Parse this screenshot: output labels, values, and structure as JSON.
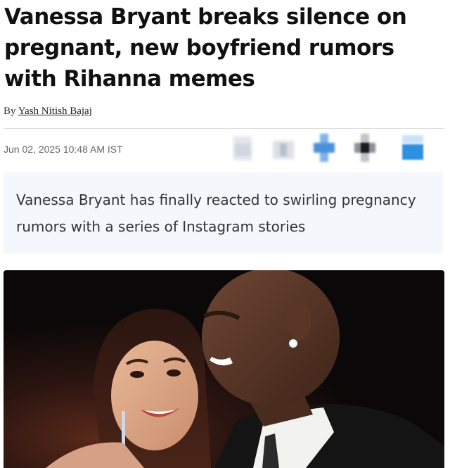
{
  "article": {
    "headline": "Vanessa Bryant breaks silence on pregnant, new boyfriend rumors with Rihanna memes",
    "byline_prefix": "By",
    "author": "Yash Nitish Bajaj",
    "timestamp": "Jun 02, 2025 10:48 AM IST",
    "summary": "Vanessa Bryant has finally reacted to swirling pregnancy rumors with a series of Instagram stories"
  },
  "share_buttons": [
    {
      "icon": "blurred-share-icon",
      "color": "#d0d6de"
    },
    {
      "icon": "blurred-share-icon",
      "color": "#c9cfd8"
    },
    {
      "icon": "blurred-share-icon",
      "color": "#4a90d9"
    },
    {
      "icon": "blurred-share-icon",
      "color": "#1a1a1a"
    },
    {
      "icon": "blurred-share-icon",
      "color": "#2f8fe0"
    }
  ],
  "colors": {
    "summary_background": "#f4f7fb",
    "rule": "#dcdcdc"
  }
}
